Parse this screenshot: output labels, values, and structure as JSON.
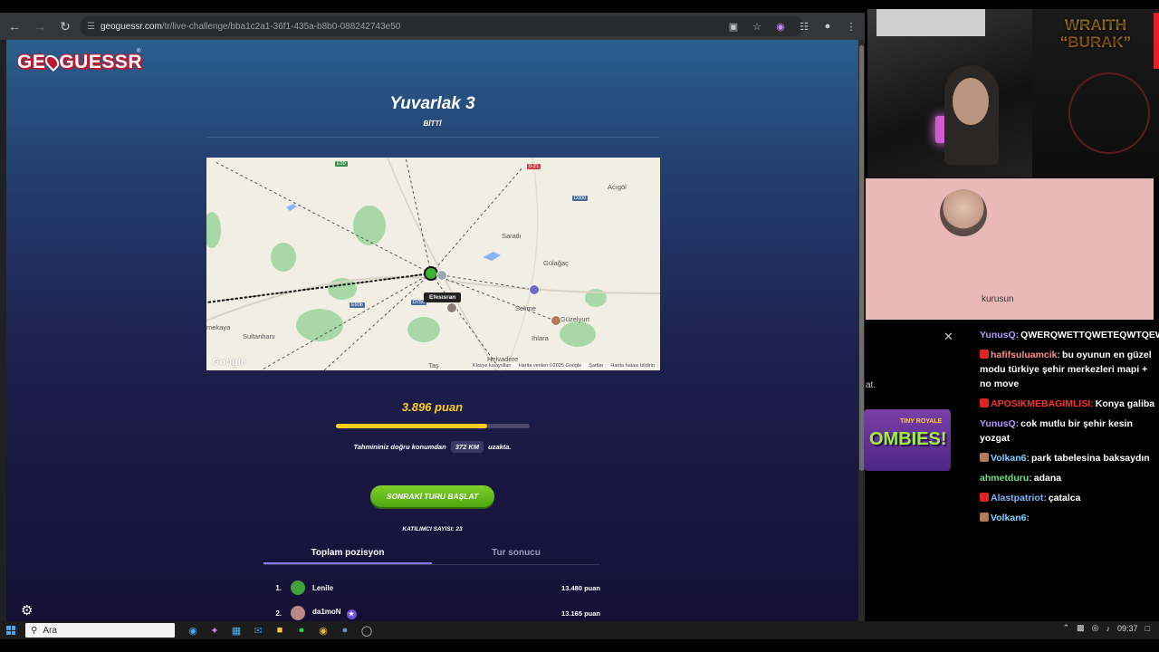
{
  "browser": {
    "url_host": "geoguessr.com",
    "url_path": "/tr/live-challenge/bba1c2a1-36f1-435a-b8b0-088242743e50"
  },
  "game": {
    "logo": "GEOGUESSR",
    "round_title": "Yuvarlak 3",
    "round_status": "BİTTİ",
    "score": "3.896 puan",
    "score_fraction": 0.78,
    "distance_prefix": "Tahmininiz doğru konumdan",
    "distance_value": "372 KM",
    "distance_suffix": "uzakta.",
    "next_button": "SONRAKİ TURU BAŞLAT",
    "participants": "KATILIMCI SAYISI: 23",
    "tabs": [
      "Toplam pozisyon",
      "Tur sonucu"
    ],
    "leaderboard": [
      {
        "rank": "1.",
        "name": "Lenile",
        "points": "13.480 puan",
        "color": "#3fa23a"
      },
      {
        "rank": "2.",
        "name": "da1moN",
        "points": "13.165 puan",
        "color": "#b98a83"
      }
    ]
  },
  "map": {
    "places": [
      "Acıgöl",
      "Saratlı",
      "Gülağaç",
      "Selime",
      "Ihlara",
      "Sultanhanı",
      "mekaya",
      "Güzelyurt",
      "Helvadere",
      "Taş"
    ],
    "roads": [
      "E90",
      "0-21",
      "D300",
      "D750",
      "E90b"
    ],
    "tooltip": "Efesısran",
    "google": "Google",
    "footer": [
      "Klavye kısayolları",
      "Harita verileri ©2025 Google",
      "Şartlar",
      "Harita hatası bildirin"
    ]
  },
  "stream": {
    "brand_line1": "WRAITH",
    "brand_line2": "“BURAK”",
    "call_name": "kurusun",
    "stub_text": "at.",
    "game_card_1": "TINY ROYALE",
    "game_card_2": "OMBIES!",
    "chat": [
      {
        "user": "YunusQ:",
        "text": "QWERQWETTQWETEQWTQEWWEQT",
        "color": "#b49cff",
        "icon": ""
      },
      {
        "user": "hafifsuluamcik:",
        "text": "bu oyunun en güzel modu türkiye şehir merkezleri mapi + no move",
        "color": "#ff8c8c",
        "icon": "#e02525"
      },
      {
        "user": "APOSIKMEBAGIMLISI:",
        "text": "Konya galiba",
        "color": "#ff3030",
        "icon": "#e02525"
      },
      {
        "user": "YunusQ:",
        "text": "cok mutlu bir şehir kesin yozgat",
        "color": "#b49cff",
        "icon": ""
      },
      {
        "user": "Volkan6:",
        "text": "park tabelesina baksaydın",
        "color": "#7fd1ff",
        "icon": "#b57a5a"
      },
      {
        "user": "ahmetduru:",
        "text": "adana",
        "color": "#6fe08a",
        "icon": ""
      },
      {
        "user": "Alastpatriot:",
        "text": "çatalca",
        "color": "#7fb6ff",
        "icon": "#e02525"
      },
      {
        "user": "Volkan6:",
        "text": "",
        "color": "#7fd1ff",
        "icon": "#b57a5a"
      }
    ]
  },
  "taskbar": {
    "search": "Ara",
    "time": "09:37"
  }
}
